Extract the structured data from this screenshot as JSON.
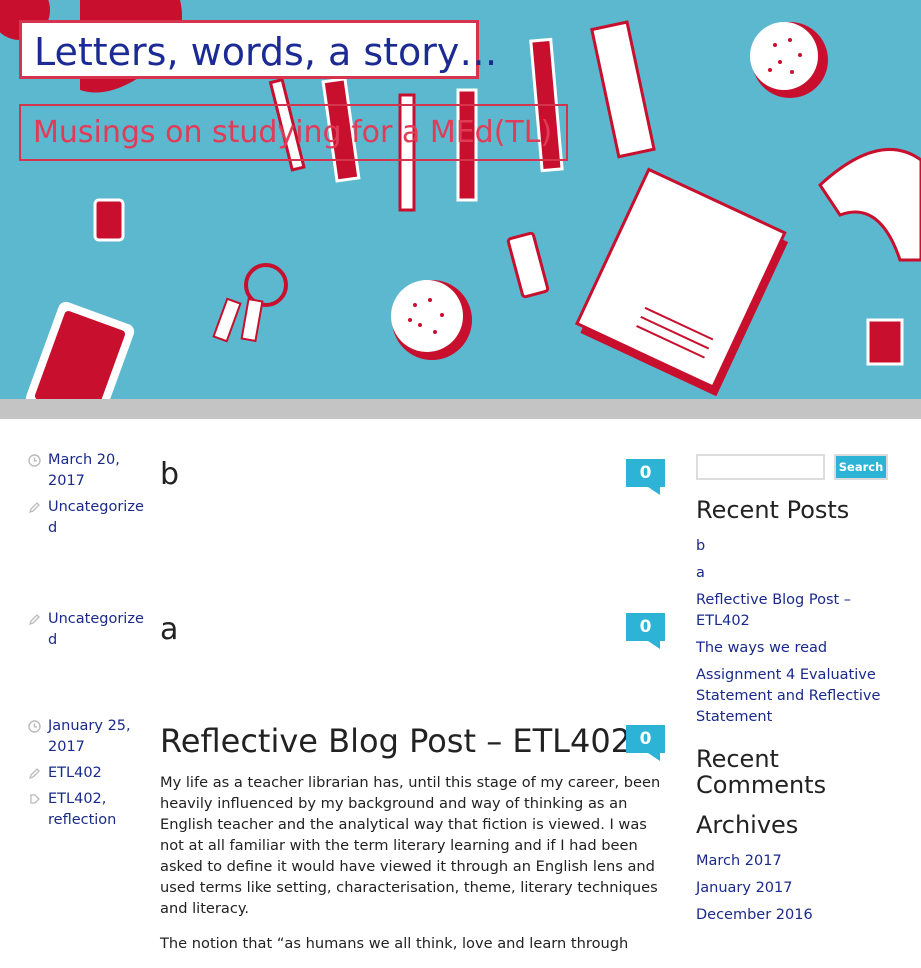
{
  "site": {
    "title": "Letters, words, a story…",
    "tagline": "Musings on studying for a MEd(TL)"
  },
  "posts": [
    {
      "date": "March 20, 2017",
      "category": "Uncategorized",
      "title": "b",
      "comments": "0"
    },
    {
      "category": "Uncategorized",
      "title": "a",
      "comments": "0"
    },
    {
      "date": "January 25, 2017",
      "category": "ETL402",
      "tags": "ETL402, reflection",
      "title": "Reflective Blog Post – ETL402",
      "comments": "0",
      "excerpt": [
        "My life as a teacher librarian has, until this stage of my career, been heavily influenced by my background and way of thinking as an English teacher and the analytical way that fiction is viewed. I was not at all familiar with the term literary learning and if I had been asked to define it would have viewed it through an English lens and used terms like setting, characterisation, theme, literary techniques and literacy.",
        "The notion that “as humans we all think, love and learn through"
      ]
    }
  ],
  "sidebar": {
    "search_button": "Search",
    "search_placeholder": "",
    "recent_posts_title": "Recent Posts",
    "recent_posts": [
      "b",
      "a",
      "Reflective Blog Post – ETL402",
      "The ways we read",
      "Assignment 4 Evaluative Statement and Reflective Statement"
    ],
    "recent_comments_title": "Recent Comments",
    "archives_title": "Archives",
    "archives": [
      "March 2017",
      "January 2017",
      "December 2016"
    ]
  },
  "colors": {
    "header_bg": "#5bb8cf",
    "accent_red": "#d6334f",
    "link_blue": "#1a2a8a",
    "comment_bubble": "#2cb3d6"
  }
}
